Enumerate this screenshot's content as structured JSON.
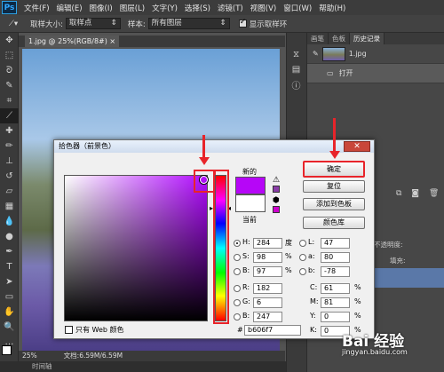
{
  "app": {
    "logo": "Ps"
  },
  "menu": [
    "文件(F)",
    "编辑(E)",
    "图像(I)",
    "图层(L)",
    "文字(Y)",
    "选择(S)",
    "滤镜(T)",
    "视图(V)",
    "窗口(W)",
    "帮助(H)"
  ],
  "options": {
    "sample_size_label": "取样大小:",
    "sample_size_value": "取样点",
    "sample_label": "样本:",
    "sample_value": "所有图层",
    "show_ring_label": "显示取样环"
  },
  "document": {
    "tab_title": "1.jpg @ 25%(RGB/8#)",
    "zoom": "25%",
    "doc_size": "文档:6.59M/6.59M"
  },
  "bottom": {
    "label": "时间轴"
  },
  "right_panel": {
    "tabs": [
      "画笔",
      "色板",
      "历史记录"
    ],
    "history": [
      {
        "label": "1.jpg"
      },
      {
        "label": "打开"
      }
    ],
    "opacity_label": "不透明度:",
    "fill_label": "填充:"
  },
  "dialog": {
    "title": "拾色器（前景色）",
    "new_label": "新的",
    "current_label": "当前",
    "new_color": "#b606f7",
    "current_color": "#ffffff",
    "buttons": {
      "ok": "确定",
      "reset": "复位",
      "add_swatch": "添加到色板",
      "color_libraries": "颜色库"
    },
    "web_only_label": "只有 Web 颜色",
    "hsb": {
      "H": "284",
      "S": "98",
      "B": "97",
      "H_unit": "度",
      "S_unit": "%",
      "B_unit": "%"
    },
    "rgb": {
      "R": "182",
      "G": "6",
      "B": "247"
    },
    "lab": {
      "L": "47",
      "a": "80",
      "b": "-78"
    },
    "cmyk": {
      "C": "61",
      "M": "81",
      "Y": "0",
      "K": "0",
      "unit": "%"
    },
    "hex_label": "#",
    "hex": "b606f7"
  },
  "watermark": {
    "text": "Bai 经验",
    "url": "jingyan.baidu.com"
  },
  "colors": {
    "highlight": "#e8242a",
    "accent": "#b606f7"
  }
}
